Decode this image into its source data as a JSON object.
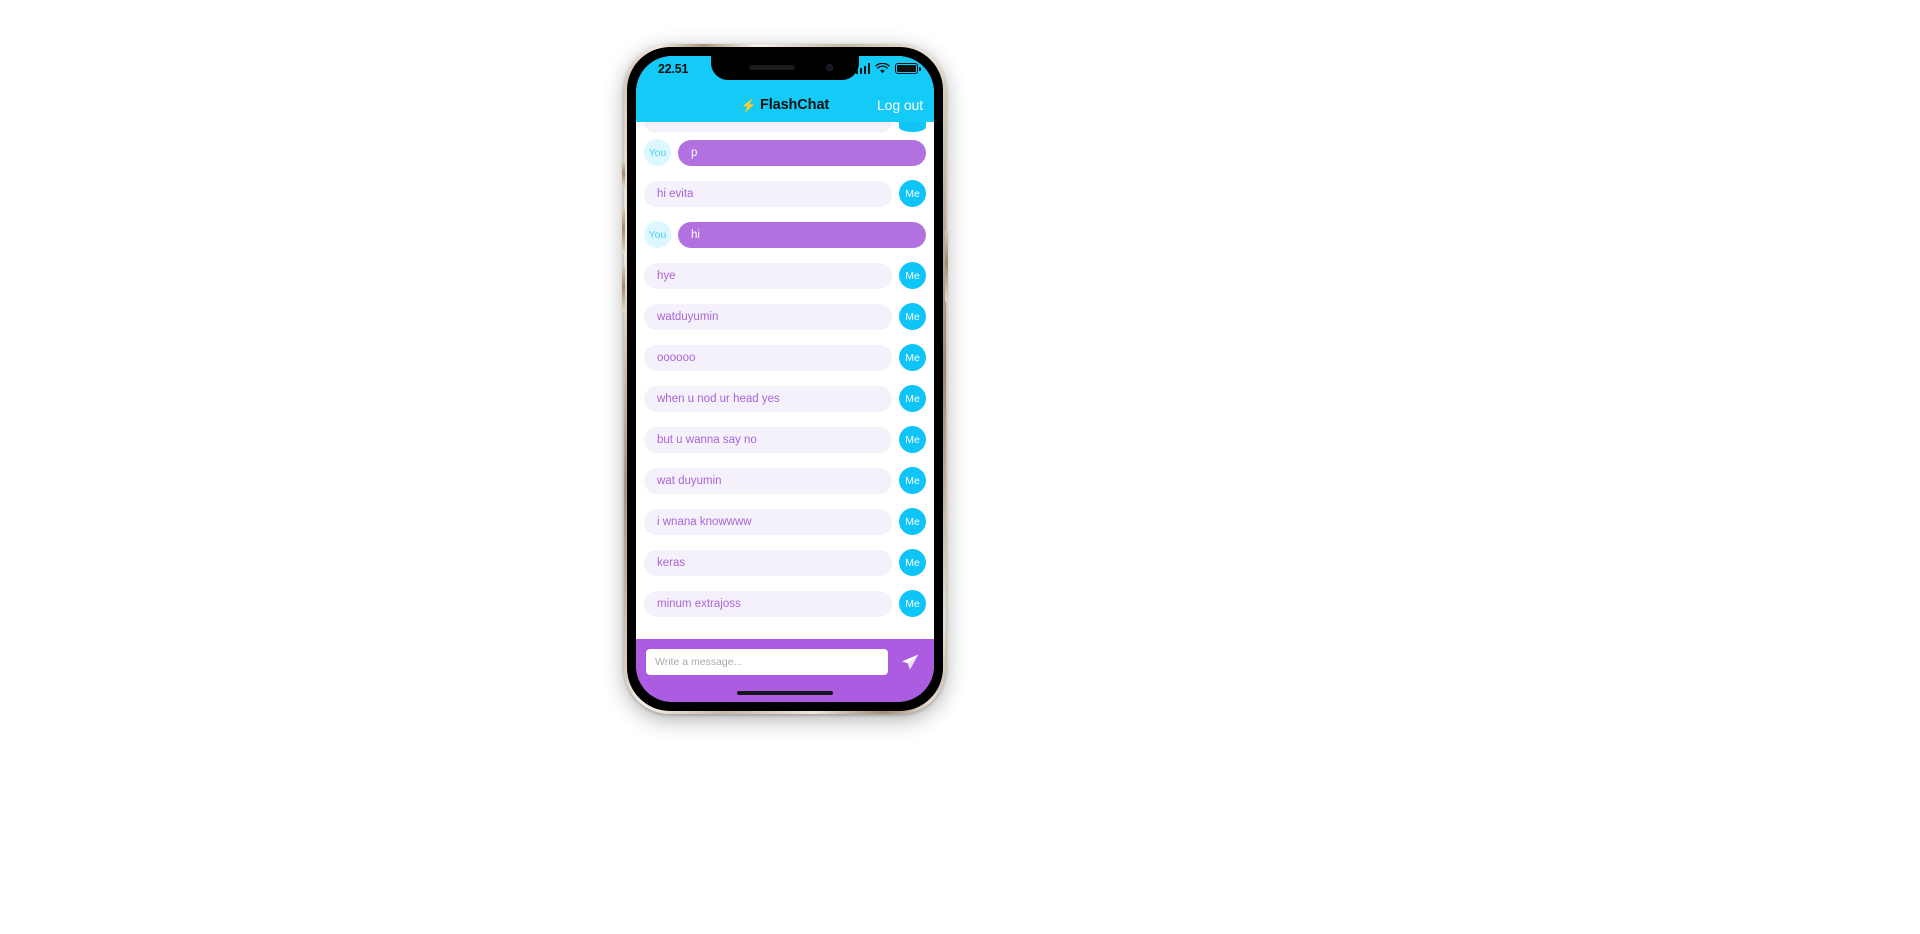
{
  "status_bar": {
    "time": "22.51",
    "signal_icon": "cellular-signal-icon",
    "wifi_icon": "wifi-icon",
    "battery_icon": "battery-full-icon"
  },
  "nav": {
    "bolt_glyph": "⚡",
    "title": "FlashChat",
    "logout_label": "Log out"
  },
  "theme": {
    "header_blue": "#14cbf8",
    "bubble_purple": "#b172e0",
    "bubble_lavender": "#f5f1fb",
    "bubble_text_purple": "#a964d8",
    "me_badge_cyan": "#0fc4f7",
    "you_badge_bg": "#dcf7ff",
    "you_badge_text": "#4fd2f2",
    "composer_purple": "#ab5ce0"
  },
  "messages": [
    {
      "sender": "Me",
      "badge": "Me",
      "text": "",
      "partial": true
    },
    {
      "sender": "You",
      "badge": "You",
      "text": "p",
      "partial": false
    },
    {
      "sender": "Me",
      "badge": "Me",
      "text": "hi evita",
      "partial": false
    },
    {
      "sender": "You",
      "badge": "You",
      "text": "hi",
      "partial": false
    },
    {
      "sender": "Me",
      "badge": "Me",
      "text": "hye",
      "partial": false
    },
    {
      "sender": "Me",
      "badge": "Me",
      "text": "watduyumin",
      "partial": false
    },
    {
      "sender": "Me",
      "badge": "Me",
      "text": "oooooo",
      "partial": false
    },
    {
      "sender": "Me",
      "badge": "Me",
      "text": "when u nod ur head yes",
      "partial": false
    },
    {
      "sender": "Me",
      "badge": "Me",
      "text": "but u wanna say no",
      "partial": false
    },
    {
      "sender": "Me",
      "badge": "Me",
      "text": "wat duyumin",
      "partial": false
    },
    {
      "sender": "Me",
      "badge": "Me",
      "text": "i wnana knowwww",
      "partial": false
    },
    {
      "sender": "Me",
      "badge": "Me",
      "text": "keras",
      "partial": false
    },
    {
      "sender": "Me",
      "badge": "Me",
      "text": "minum extrajoss",
      "partial": false
    }
  ],
  "composer": {
    "placeholder": "Write a message...",
    "value": "",
    "send_icon": "send-paper-plane-icon"
  }
}
